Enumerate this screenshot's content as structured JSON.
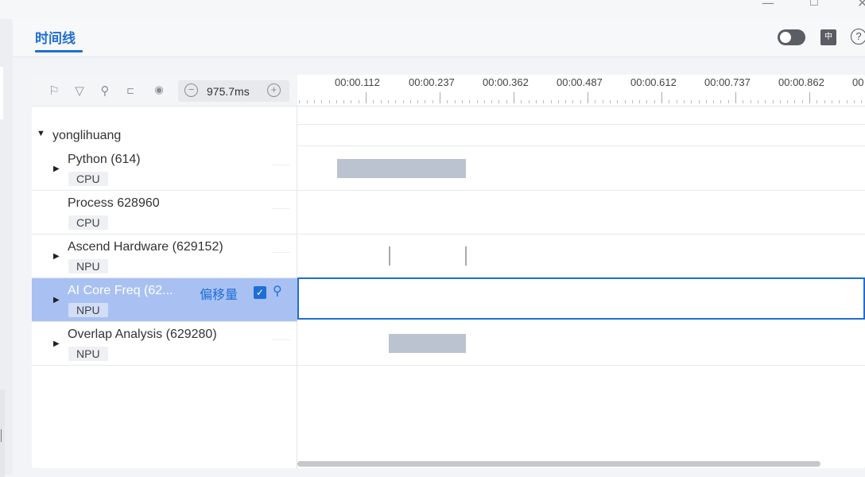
{
  "tab": {
    "title": "时间线"
  },
  "header_controls": {
    "lang_icon_text": "中",
    "help_symbol": "?"
  },
  "toolbar": {
    "icons": [
      "flag-icon",
      "filter-icon",
      "search-icon",
      "link-icon",
      "locate-icon"
    ],
    "zoom_value": "975.7ms",
    "zoom_out_symbol": "−",
    "zoom_in_symbol": "+"
  },
  "ruler": {
    "labels": [
      "00:00.112",
      "00:00.237",
      "00:00.362",
      "00:00.487",
      "00:00.612",
      "00:00.737",
      "00:00.862",
      "00"
    ]
  },
  "tree": {
    "group_label": "yonglihuang",
    "rows": [
      {
        "name": "Python (614)",
        "tag": "CPU",
        "expandable": true
      },
      {
        "name": "Process 628960",
        "tag": "CPU",
        "expandable": false
      },
      {
        "name": "Ascend Hardware (629152)",
        "tag": "NPU",
        "expandable": true
      },
      {
        "name": "AI Core Freq (62...",
        "tag": "NPU",
        "expandable": true,
        "selected": true,
        "offset_label": "偏移量",
        "checked": true
      },
      {
        "name": "Overlap Analysis (629280)",
        "tag": "NPU",
        "expandable": true
      }
    ]
  },
  "colors": {
    "accent": "#1f6ed4",
    "selected_row": "#a9c1f2",
    "slice": "#bcc3d0"
  }
}
